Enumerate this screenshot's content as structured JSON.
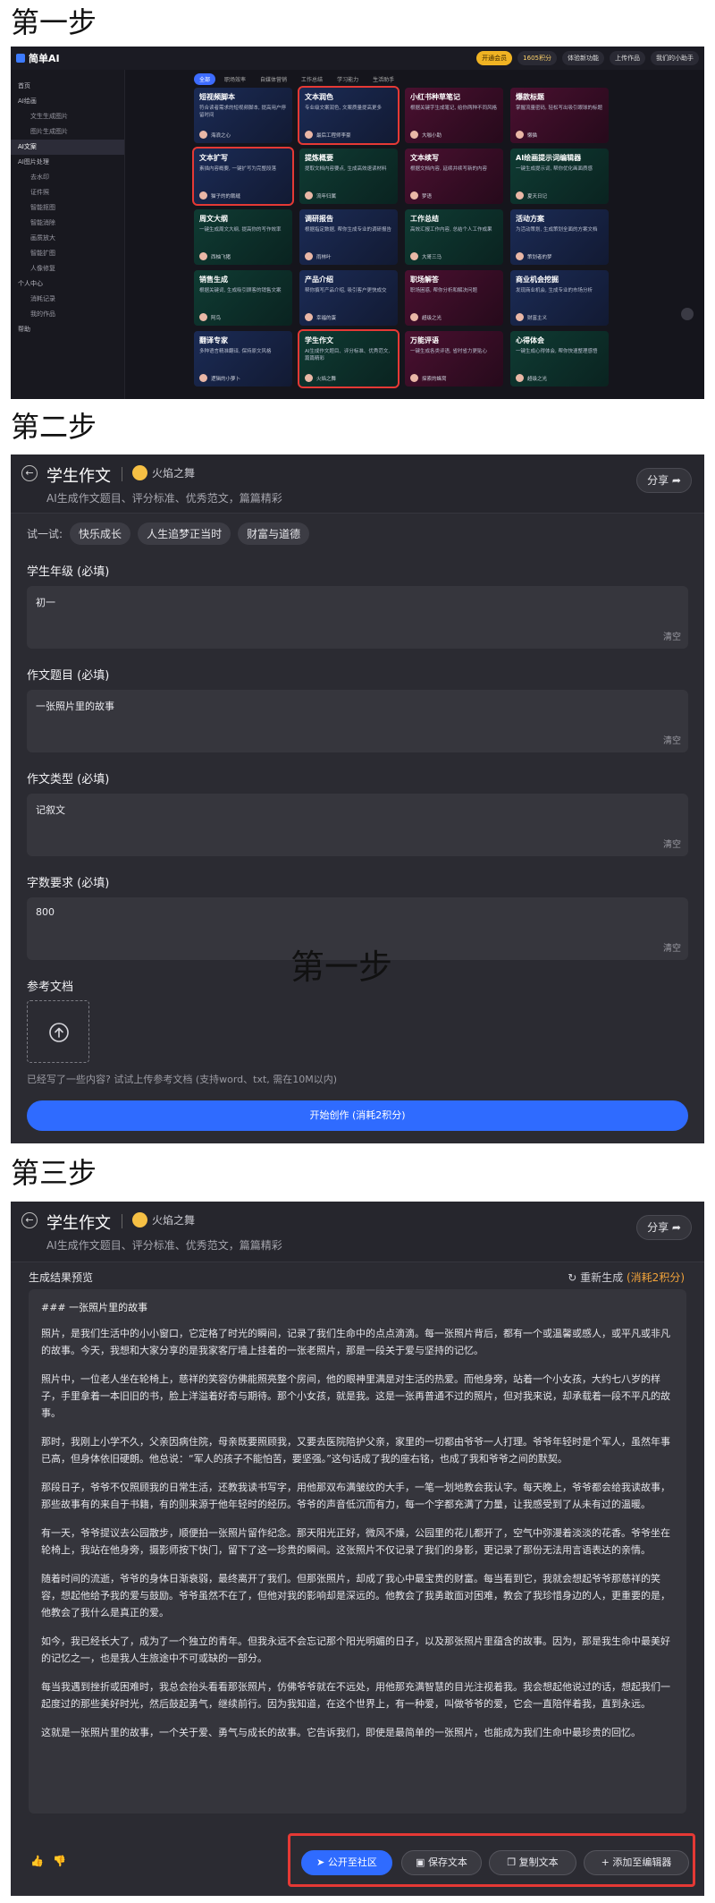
{
  "steps": [
    "第一步",
    "第二步",
    "第三步"
  ],
  "overlay_text": "第一步",
  "step1": {
    "brand": "简单AI",
    "top_pills": [
      "开通会员",
      "1605积分",
      "体验新功能",
      "上传作品",
      "我们的小助手"
    ],
    "sidebar": [
      {
        "label": "首页",
        "type": "item"
      },
      {
        "label": "AI绘画",
        "type": "item"
      },
      {
        "label": "文生生成图片",
        "type": "sub"
      },
      {
        "label": "图片生成图片",
        "type": "sub"
      },
      {
        "label": "AI文案",
        "type": "active"
      },
      {
        "label": "AI图片处理",
        "type": "item"
      },
      {
        "label": "去水印",
        "type": "sub"
      },
      {
        "label": "证件照",
        "type": "sub"
      },
      {
        "label": "智能抠图",
        "type": "sub"
      },
      {
        "label": "智能消除",
        "type": "sub"
      },
      {
        "label": "画质放大",
        "type": "sub"
      },
      {
        "label": "智能扩图",
        "type": "sub"
      },
      {
        "label": "人像修复",
        "type": "sub"
      },
      {
        "label": "个人中心",
        "type": "item"
      },
      {
        "label": "消耗记录",
        "type": "sub"
      },
      {
        "label": "我的作品",
        "type": "sub"
      },
      {
        "label": "帮助",
        "type": "item"
      }
    ],
    "tabs": [
      "全部",
      "职场效率",
      "自媒体营销",
      "工作总结",
      "学习能力",
      "生活助手"
    ],
    "cards": [
      {
        "title": "短视频脚本",
        "desc": "符合读者需求的短视频脚本, 提高用户停留时间",
        "author": "海浪之心",
        "color": "blue",
        "hl": false
      },
      {
        "title": "文本润色",
        "desc": "专业级文案润色, 文案质量提高更多",
        "author": "最后工程师李豪",
        "color": "blue",
        "hl": true
      },
      {
        "title": "小红书种草笔记",
        "desc": "根据关键字生成笔记, 给你两种不同风格",
        "author": "大咖小助",
        "color": "pink",
        "hl": false
      },
      {
        "title": "爆款标题",
        "desc": "掌握流量密码, 轻松写出吸引眼球的标题",
        "author": "懒猫",
        "color": "pink",
        "hl": false
      },
      {
        "title": "文本扩写",
        "desc": "素描内容概要, 一键扩写为完整段落",
        "author": "猫子的的裁缝",
        "color": "blue",
        "hl": true
      },
      {
        "title": "提炼概要",
        "desc": "提取文档内容要点, 生成高效速读材料",
        "author": "流年归属",
        "color": "green",
        "hl": false
      },
      {
        "title": "文本续写",
        "desc": "根据文档内容, 延续并续写新的内容",
        "author": "梦语",
        "color": "pink",
        "hl": false
      },
      {
        "title": "AI绘画提示词编辑器",
        "desc": "一键生成提示词, 帮你优化画面质感",
        "author": "夏天日记",
        "color": "green",
        "hl": false
      },
      {
        "title": "周文大纲",
        "desc": "一键生成周文大纲, 提高你的写作效率",
        "author": "西柚飞猪",
        "color": "green",
        "hl": false
      },
      {
        "title": "调研报告",
        "desc": "根据指定数据, 帮你生成专业的调研报告",
        "author": "雨林叶",
        "color": "blue",
        "hl": false
      },
      {
        "title": "工作总结",
        "desc": "高效汇报工作内容, 总结个人工作成果",
        "author": "大哥三马",
        "color": "green",
        "hl": false
      },
      {
        "title": "活动方案",
        "desc": "为活动策划, 生成策划全面的方案文档",
        "author": "策划者的梦",
        "color": "blue",
        "hl": false
      },
      {
        "title": "销售生成",
        "desc": "根据关键词, 生成吸引顾客的销售文案",
        "author": "阿鸟",
        "color": "green",
        "hl": false
      },
      {
        "title": "产品介绍",
        "desc": "帮你撰写产品介绍, 吸引客户更快成交",
        "author": "幸福的蛋",
        "color": "blue",
        "hl": false
      },
      {
        "title": "职场解答",
        "desc": "职场困惑, 帮你分析和解决问题",
        "author": "超级之光",
        "color": "pink",
        "hl": false
      },
      {
        "title": "商业机会挖掘",
        "desc": "发现商业机会, 生成专业的市场分析",
        "author": "财富主义",
        "color": "blue",
        "hl": false
      },
      {
        "title": "翻译专家",
        "desc": "多种语言精准翻译, 保持原文风格",
        "author": "逻辑的小萝卜",
        "color": "blue",
        "hl": false
      },
      {
        "title": "学生作文",
        "desc": "AI生成作文题目、评分标准、优秀范文, 篇篇精彩",
        "author": "火焰之舞",
        "color": "green",
        "hl": true
      },
      {
        "title": "万能评语",
        "desc": "一键生成各类评语, 省时省力更贴心",
        "author": "探索的蜂窝",
        "color": "pink",
        "hl": false
      },
      {
        "title": "心得体会",
        "desc": "一键生成心得体会, 帮你快速整理感悟",
        "author": "超级之光",
        "color": "green",
        "hl": false
      }
    ]
  },
  "app": {
    "title": "学生作文",
    "author": "火焰之舞",
    "subtitle": "AI生成作文题目、评分标准、优秀范文，篇篇精彩",
    "share": "分享 ➦"
  },
  "step2": {
    "try_label": "试一试:",
    "chips": [
      "快乐成长",
      "人生追梦正当时",
      "财富与道德"
    ],
    "fields": [
      {
        "label": "学生年级 (必填)",
        "value": "初一"
      },
      {
        "label": "作文题目 (必填)",
        "value": "一张照片里的故事"
      },
      {
        "label": "作文类型 (必填)",
        "value": "记叙文"
      },
      {
        "label": "字数要求 (必填)",
        "value": "800"
      }
    ],
    "clear": "清空",
    "ref_label": "参考文档",
    "upload_hint": "已经写了一些内容? 试试上传参考文档 (支持word、txt, 需在10M以内)",
    "start": "开始创作 (消耗2积分)"
  },
  "step3": {
    "result_label": "生成结果预览",
    "regen": "重新生成",
    "regen_cost": "(消耗2积分)",
    "heading": "### 一张照片里的故事",
    "paragraphs": [
      "照片，是我们生活中的小小窗口，它定格了时光的瞬间，记录了我们生命中的点点滴滴。每一张照片背后，都有一个或温馨或感人，或平凡或非凡的故事。今天，我想和大家分享的是我家客厅墙上挂着的一张老照片，那是一段关于爱与坚持的记忆。",
      "照片中，一位老人坐在轮椅上，慈祥的笑容仿佛能照亮整个房间，他的眼神里满是对生活的热爱。而他身旁，站着一个小女孩，大约七八岁的样子，手里拿着一本旧旧的书，脸上洋溢着好奇与期待。那个小女孩，就是我。这是一张再普通不过的照片，但对我来说，却承载着一段不平凡的故事。",
      "那时，我刚上小学不久，父亲因病住院，母亲既要照顾我，又要去医院陪护父亲，家里的一切都由爷爷一人打理。爷爷年轻时是个军人，虽然年事已高，但身体依旧硬朗。他总说：“军人的孩子不能怕苦，要坚强。”这句话成了我的座右铭，也成了我和爷爷之间的默契。",
      "那段日子，爷爷不仅照顾我的日常生活，还教我读书写字，用他那双布满皱纹的大手，一笔一划地教会我认字。每天晚上，爷爷都会给我读故事，那些故事有的来自于书籍，有的则来源于他年轻时的经历。爷爷的声音低沉而有力，每一个字都充满了力量，让我感受到了从未有过的温暖。",
      "有一天，爷爷提议去公园散步，顺便拍一张照片留作纪念。那天阳光正好，微风不燥，公园里的花儿都开了，空气中弥漫着淡淡的花香。爷爷坐在轮椅上，我站在他身旁，摄影师按下快门，留下了这一珍贵的瞬间。这张照片不仅记录了我们的身影，更记录了那份无法用言语表达的亲情。",
      "随着时间的流逝，爷爷的身体日渐衰弱，最终离开了我们。但那张照片，却成了我心中最宝贵的财富。每当看到它，我就会想起爷爷那慈祥的笑容，想起他给予我的爱与鼓励。爷爷虽然不在了，但他对我的影响却是深远的。他教会了我勇敢面对困难，教会了我珍惜身边的人，更重要的是，他教会了我什么是真正的爱。",
      "如今，我已经长大了，成为了一个独立的青年。但我永远不会忘记那个阳光明媚的日子，以及那张照片里蕴含的故事。因为，那是我生命中最美好的记忆之一，也是我人生旅途中不可或缺的一部分。",
      "每当我遇到挫折或困难时，我总会抬头看看那张照片，仿佛爷爷就在不远处，用他那充满智慧的目光注视着我。我会想起他说过的话，想起我们一起度过的那些美好时光，然后鼓起勇气，继续前行。因为我知道，在这个世界上，有一种爱，叫做爷爷的爱，它会一直陪伴着我，直到永远。",
      "这就是一张照片里的故事，一个关于爱、勇气与成长的故事。它告诉我们，即使是最简单的一张照片，也能成为我们生命中最珍贵的回忆。"
    ],
    "thumbs": [
      "👍",
      "👎"
    ],
    "actions": [
      "公开至社区",
      "保存文本",
      "复制文本",
      "添加至编辑器"
    ]
  }
}
